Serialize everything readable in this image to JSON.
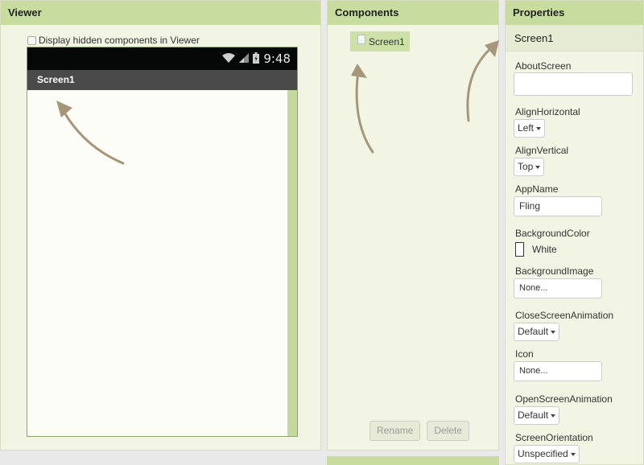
{
  "viewer": {
    "title": "Viewer",
    "hidden_components_label": "Display hidden components in Viewer",
    "status_time": "9:48",
    "screen_title": "Screen1"
  },
  "components": {
    "title": "Components",
    "tree_item": "Screen1",
    "rename_label": "Rename",
    "delete_label": "Delete"
  },
  "properties": {
    "title": "Properties",
    "selected": "Screen1",
    "about_screen": {
      "label": "AboutScreen",
      "value": ""
    },
    "align_horizontal": {
      "label": "AlignHorizontal",
      "value": "Left"
    },
    "align_vertical": {
      "label": "AlignVertical",
      "value": "Top"
    },
    "app_name": {
      "label": "AppName",
      "value": "Fling"
    },
    "background_color": {
      "label": "BackgroundColor",
      "value": "White"
    },
    "background_image": {
      "label": "BackgroundImage",
      "value": "None..."
    },
    "close_screen_animation": {
      "label": "CloseScreenAnimation",
      "value": "Default"
    },
    "icon": {
      "label": "Icon",
      "value": "None..."
    },
    "open_screen_animation": {
      "label": "OpenScreenAnimation",
      "value": "Default"
    },
    "screen_orientation": {
      "label": "ScreenOrientation",
      "value": "Unspecified"
    }
  },
  "colors": {
    "header": "#c9dca0",
    "panel": "#f3f5e4",
    "arrow": "#a6977a"
  }
}
